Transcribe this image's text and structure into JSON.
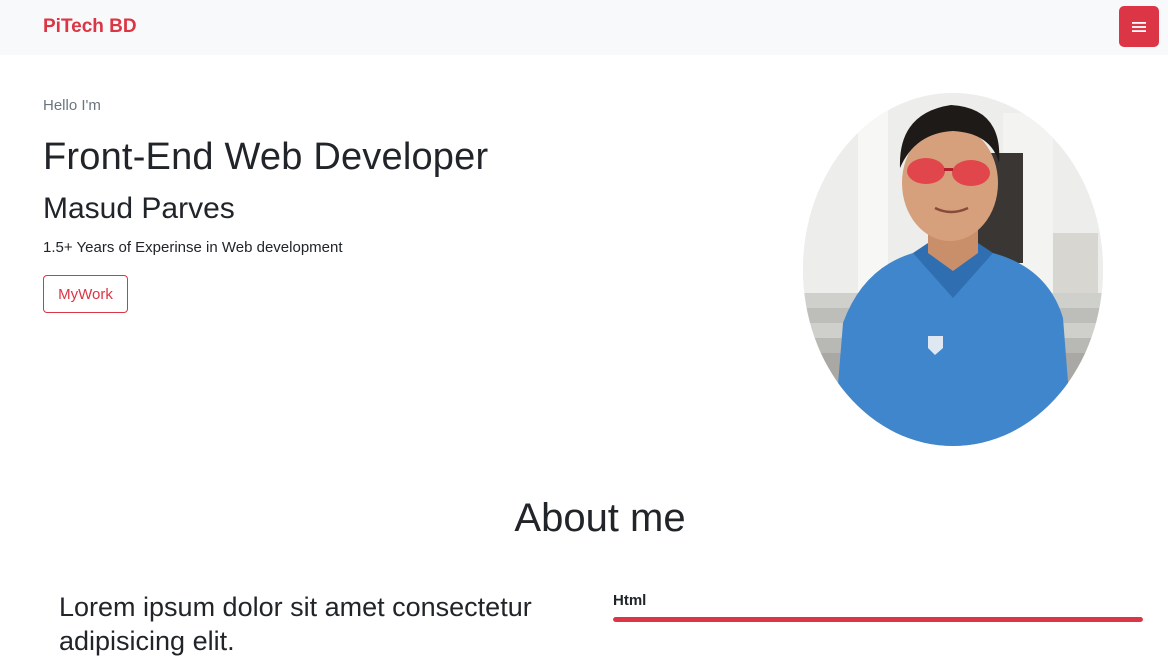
{
  "navbar": {
    "brand": "PiTech BD",
    "menu_icon": "hamburger-menu-icon",
    "brand_color": "#dc3545"
  },
  "hero": {
    "greeting": "Hello I'm",
    "role": "Front-End Web Developer",
    "name": "Masud Parves",
    "experience": "1.5+ Years of Experinse in Web development",
    "cta_label": "MyWork",
    "profile_image": "profile-photo"
  },
  "about": {
    "title": "About me",
    "headline": "Lorem ipsum dolor sit amet consectetur adipisicing elit.",
    "skills": [
      {
        "label": "Html",
        "percent": 100
      }
    ]
  },
  "colors": {
    "accent": "#dc3545",
    "navbar_bg": "#f8f9fa",
    "muted_text": "#6c757d"
  }
}
